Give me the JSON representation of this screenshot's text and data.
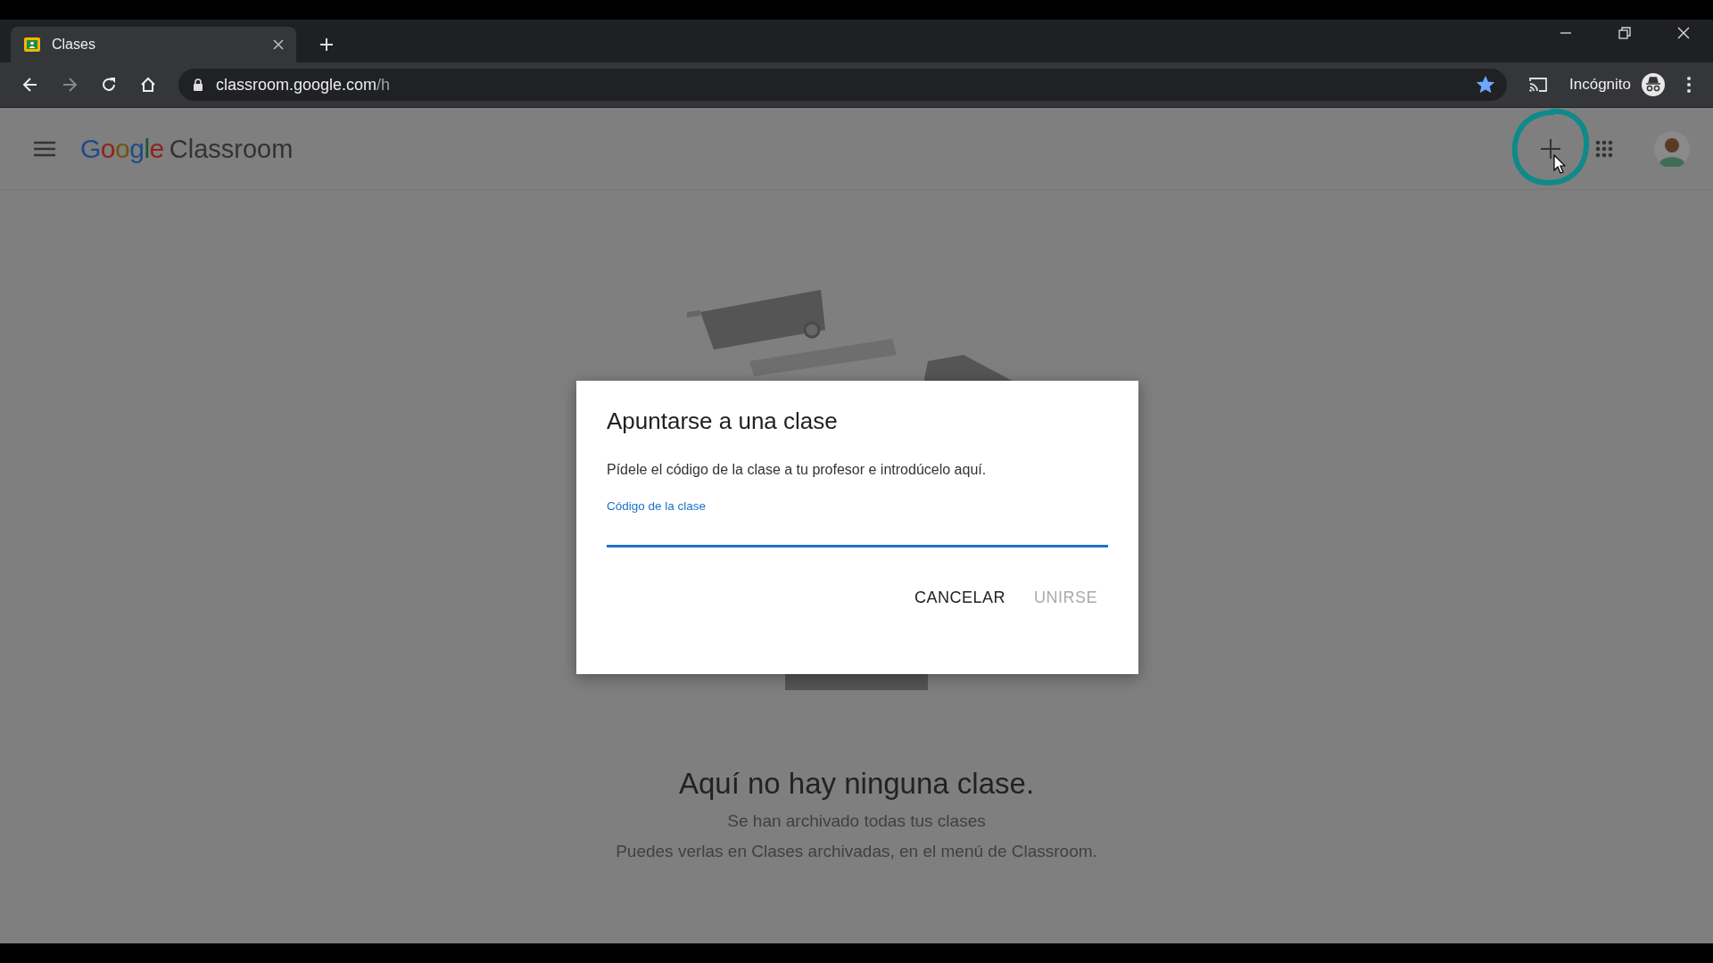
{
  "browser": {
    "tab": {
      "title": "Clases",
      "selected": true
    },
    "url": {
      "host": "classroom.google.com",
      "path": "/h"
    },
    "bookmarked": true,
    "profile_label": "Incógnito"
  },
  "app": {
    "logo_word": "Google",
    "product": "Classroom"
  },
  "empty_state": {
    "title": "Aquí no hay ninguna clase.",
    "lines": [
      "Se han archivado todas tus clases",
      "Puedes verlas en Clases archivadas, en el menú de Classroom."
    ]
  },
  "dialog": {
    "title": "Apuntarse a una clase",
    "instructions": "Pídele el código de la clase a tu profesor e introdúcelo aquí.",
    "field": {
      "label": "Código de la clase",
      "focused": true
    },
    "buttons": [
      {
        "label": "CANCELAR",
        "disabled": false
      },
      {
        "label": "UNIRSE",
        "disabled": true
      }
    ]
  }
}
